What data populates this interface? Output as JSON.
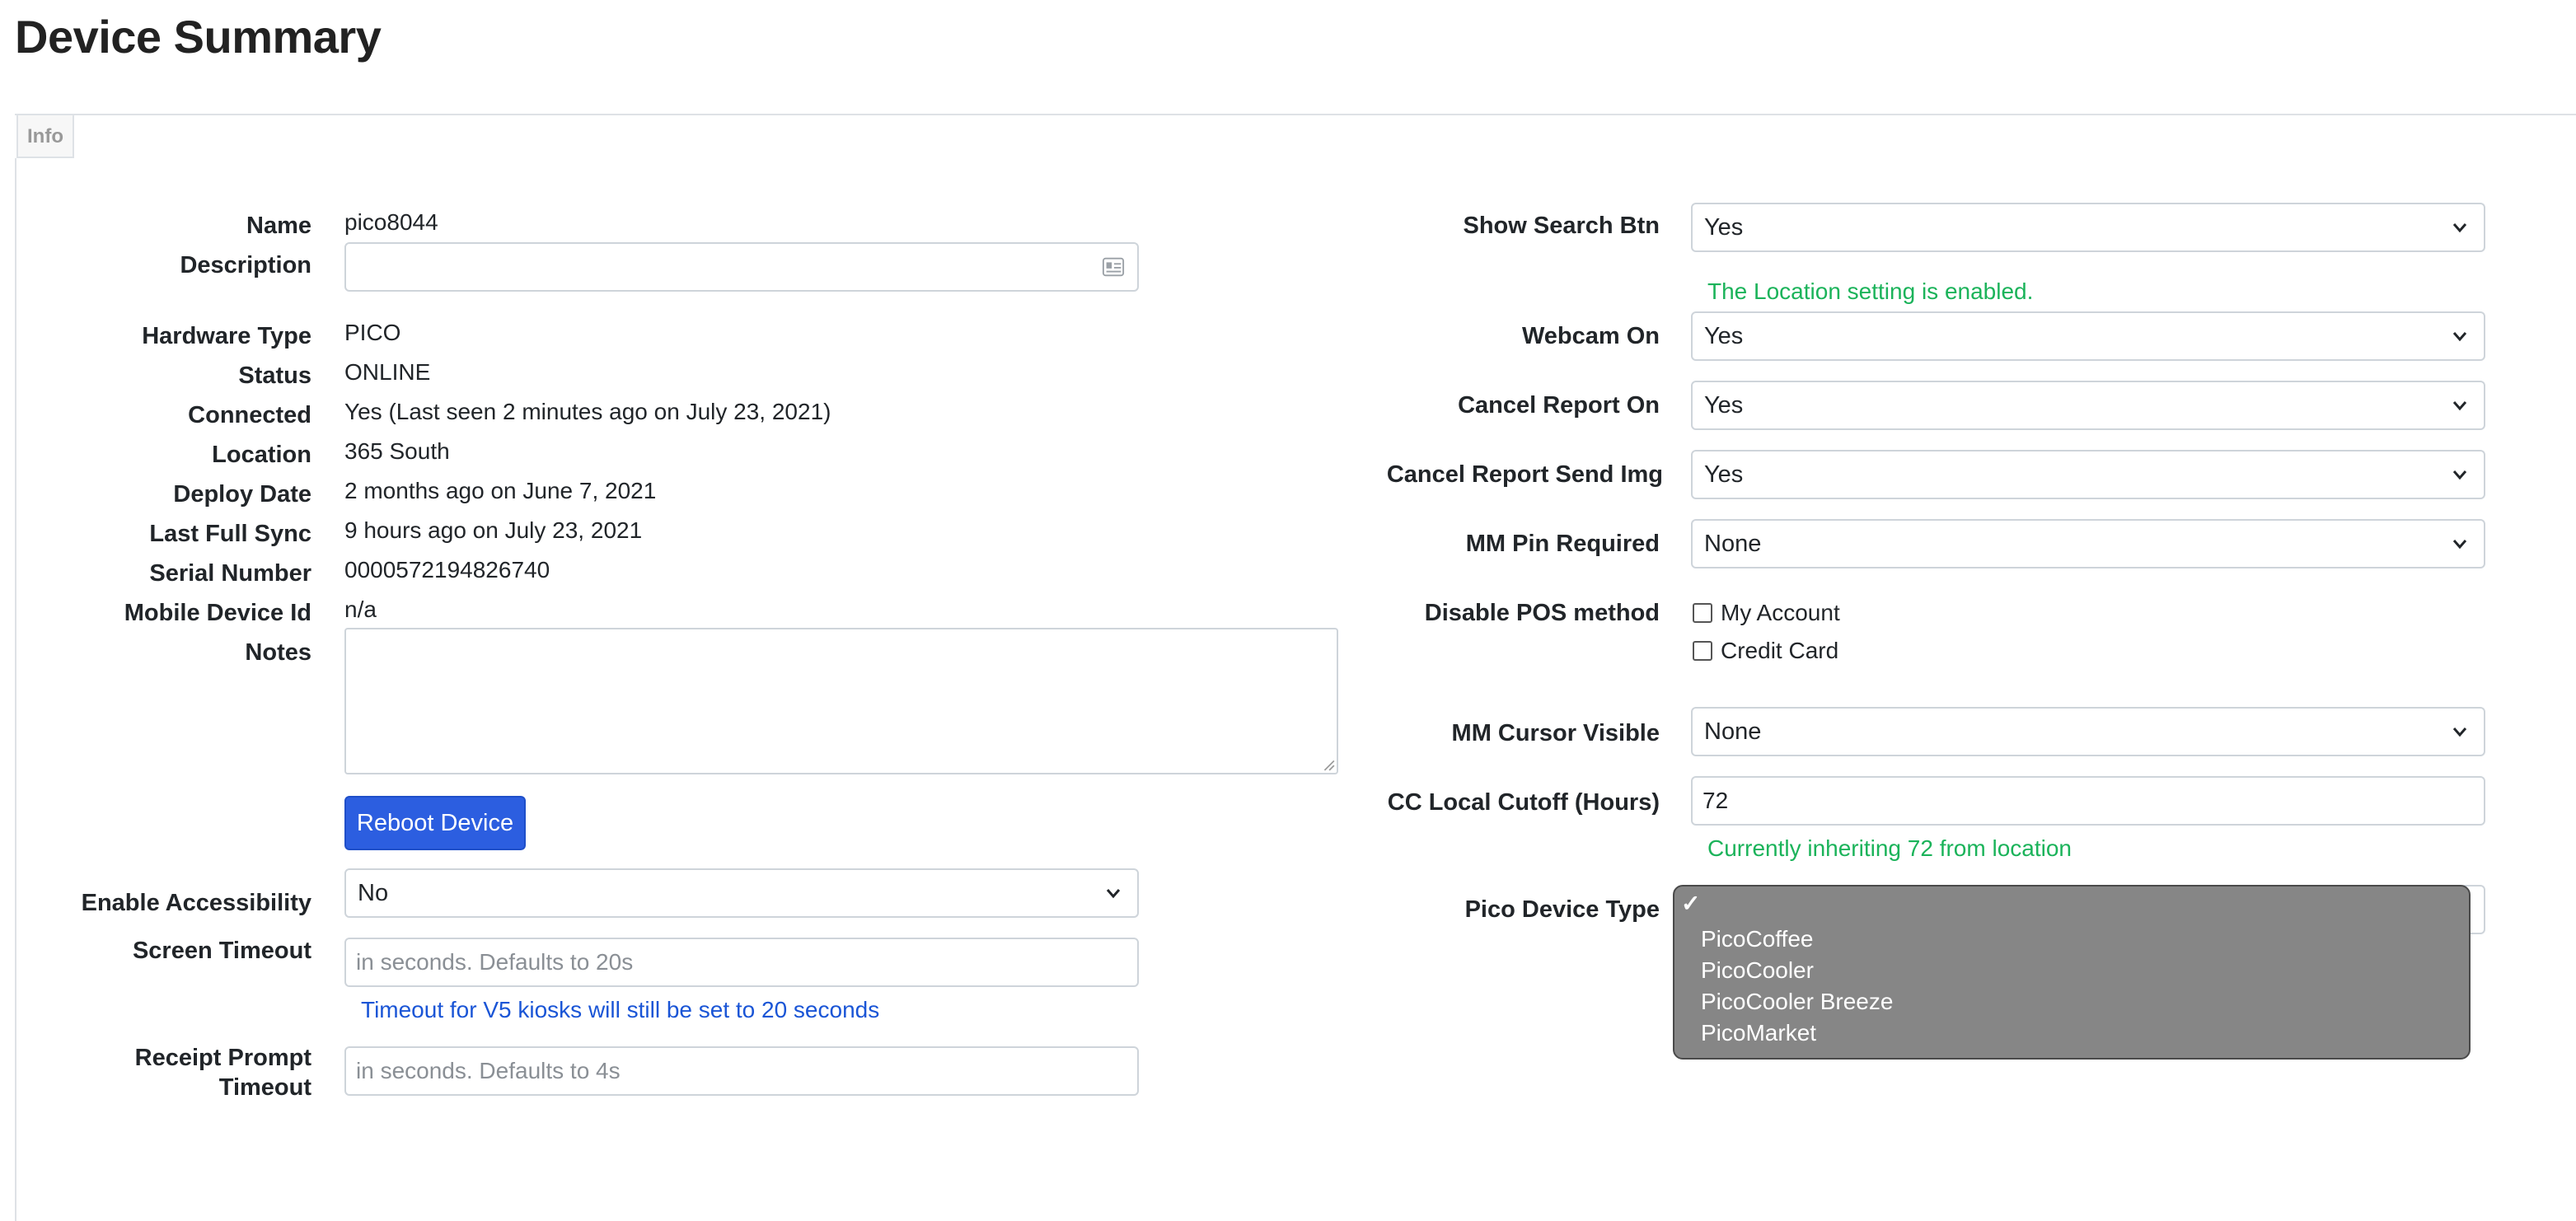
{
  "page": {
    "title": "Device Summary"
  },
  "tabs": [
    {
      "label": "Info"
    }
  ],
  "left": {
    "name": {
      "label": "Name",
      "value": "pico8044"
    },
    "description": {
      "label": "Description",
      "value": ""
    },
    "hardware_type": {
      "label": "Hardware Type",
      "value": "PICO"
    },
    "status": {
      "label": "Status",
      "value": "ONLINE"
    },
    "connected": {
      "label": "Connected",
      "value": "Yes (Last seen 2 minutes ago on July 23, 2021)"
    },
    "location": {
      "label": "Location",
      "value": "365 South"
    },
    "deploy_date": {
      "label": "Deploy Date",
      "value": "2 months ago on June 7, 2021"
    },
    "last_full_sync": {
      "label": "Last Full Sync",
      "value": "9 hours ago on July 23, 2021"
    },
    "serial_number": {
      "label": "Serial Number",
      "value": "0000572194826740"
    },
    "mobile_device_id": {
      "label": "Mobile Device Id",
      "value": "n/a"
    },
    "notes": {
      "label": "Notes",
      "value": ""
    },
    "reboot_button": "Reboot Device",
    "enable_accessibility": {
      "label": "Enable Accessibility",
      "selected": "No"
    },
    "screen_timeout": {
      "label": "Screen Timeout",
      "placeholder": "in seconds. Defaults to 20s",
      "help": "Timeout for V5 kiosks will still be set to 20 seconds"
    },
    "receipt_prompt_timeout": {
      "label_line1": "Receipt Prompt",
      "label_line2": "Timeout",
      "placeholder": "in seconds. Defaults to 4s"
    }
  },
  "right": {
    "show_search_btn": {
      "label": "Show Search Btn",
      "selected": "Yes",
      "help": "The Location setting is enabled."
    },
    "webcam_on": {
      "label": "Webcam On",
      "selected": "Yes"
    },
    "cancel_report_on": {
      "label": "Cancel Report On",
      "selected": "Yes"
    },
    "cancel_report_send_img": {
      "label": "Cancel Report Send Img",
      "selected": "Yes"
    },
    "mm_pin_required": {
      "label": "MM Pin Required",
      "selected": "None"
    },
    "disable_pos_method": {
      "label": "Disable POS method",
      "options": [
        {
          "label": "My Account",
          "checked": false
        },
        {
          "label": "Credit Card",
          "checked": false
        }
      ]
    },
    "mm_cursor_visible": {
      "label": "MM Cursor Visible",
      "selected": "None"
    },
    "cc_local_cutoff": {
      "label": "CC Local Cutoff (Hours)",
      "value": "72",
      "help": "Currently inheriting 72 from location"
    },
    "pico_device_type": {
      "label": "Pico Device Type",
      "checkmark": "✓",
      "selected": "",
      "options": [
        "",
        "PicoCoffee",
        "PicoCooler",
        "PicoCooler Breeze",
        "PicoMarket"
      ]
    }
  },
  "icons": {
    "description_field": "contact-card-icon",
    "select": "chevron-down-icon",
    "dropdown_check": "checkmark-icon"
  },
  "colors": {
    "primary": "#2c5ee0",
    "success_text": "#1bb35a",
    "info_text": "#1a55d6",
    "dropdown_bg": "#868686"
  }
}
